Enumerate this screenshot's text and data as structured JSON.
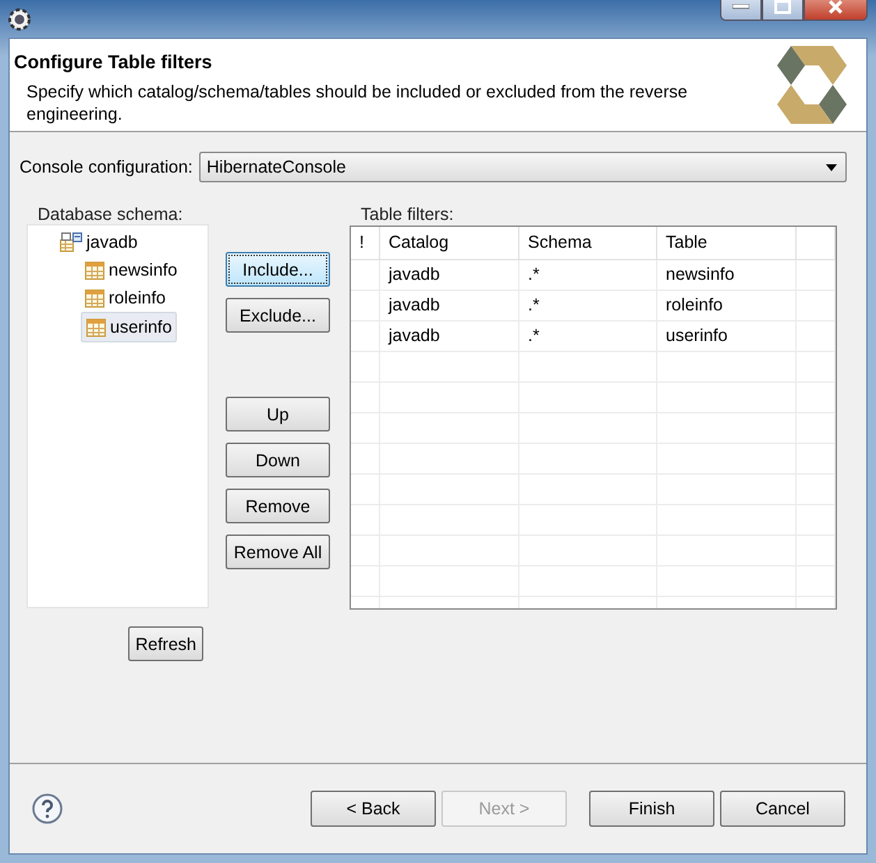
{
  "header": {
    "title": "Configure Table filters",
    "description": "Specify which catalog/schema/tables should be included or excluded from the reverse engineering."
  },
  "console": {
    "label": "Console configuration:",
    "value": "HibernateConsole"
  },
  "schema_tree": {
    "label": "Database schema:",
    "items": [
      {
        "label": "javadb",
        "kind": "schema",
        "selected": false,
        "children": [
          {
            "label": "newsinfo",
            "kind": "table",
            "selected": false
          },
          {
            "label": "roleinfo",
            "kind": "table",
            "selected": false
          },
          {
            "label": "userinfo",
            "kind": "table",
            "selected": true
          }
        ]
      }
    ]
  },
  "refresh_button": "Refresh",
  "action_buttons": [
    {
      "label": "Include...",
      "focused": true
    },
    {
      "label": "Exclude...",
      "focused": false
    },
    {
      "label": "Up",
      "focused": false
    },
    {
      "label": "Down",
      "focused": false
    },
    {
      "label": "Remove",
      "focused": false
    },
    {
      "label": "Remove All",
      "focused": false
    }
  ],
  "table": {
    "label": "Table filters:",
    "columns": [
      "!",
      "Catalog",
      "Schema",
      "Table"
    ],
    "rows": [
      [
        "",
        "javadb",
        ".*",
        "newsinfo"
      ],
      [
        "",
        "javadb",
        ".*",
        "roleinfo"
      ],
      [
        "",
        "javadb",
        ".*",
        "userinfo"
      ]
    ]
  },
  "footer_buttons": [
    {
      "label": "< Back",
      "disabled": false
    },
    {
      "label": "Next >",
      "disabled": true
    },
    {
      "label": "Finish",
      "disabled": false
    },
    {
      "label": "Cancel",
      "disabled": false
    }
  ]
}
